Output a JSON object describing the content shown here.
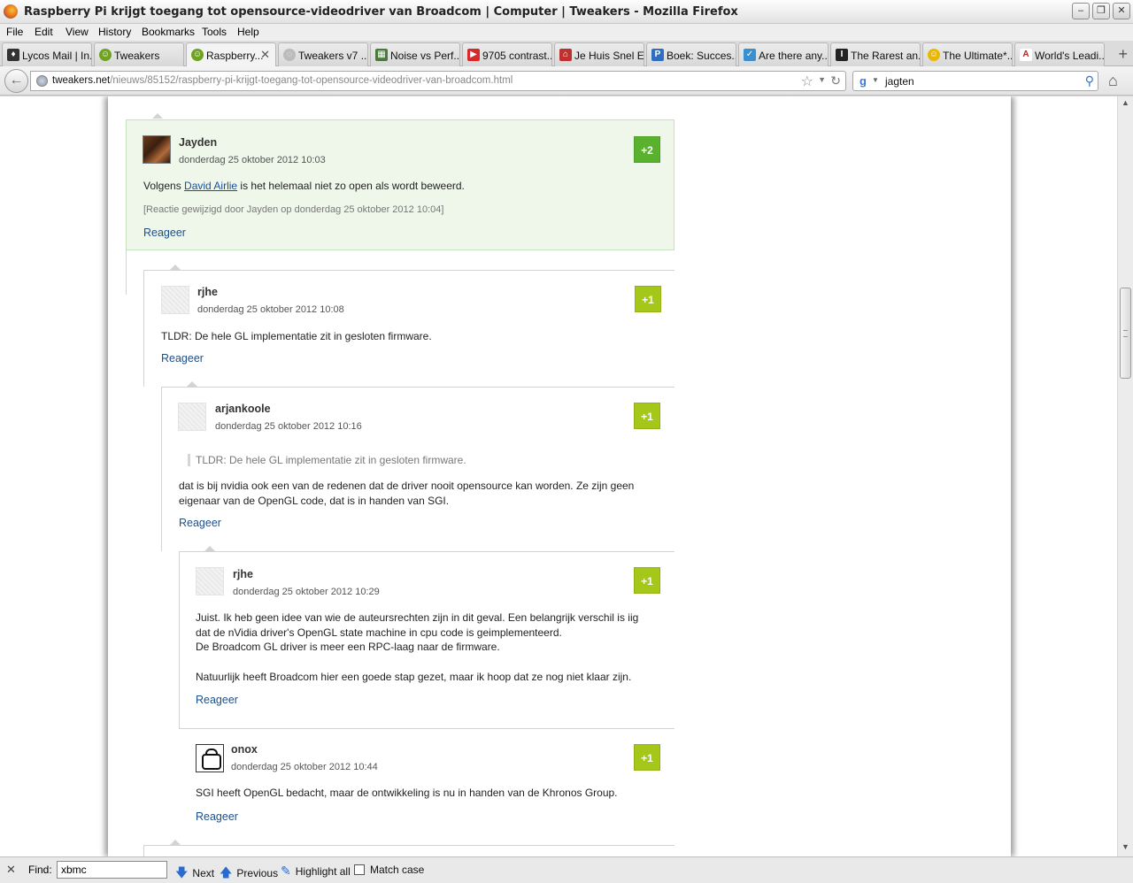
{
  "window": {
    "title": "Raspberry Pi krijgt toegang tot opensource-videodriver van Broadcom | Computer | Tweakers - Mozilla Firefox"
  },
  "menu": [
    "File",
    "Edit",
    "View",
    "History",
    "Bookmarks",
    "Tools",
    "Help"
  ],
  "tabs": [
    {
      "label": "Lycos Mail | In...",
      "icon": "dog-icon",
      "color": "#333333"
    },
    {
      "label": "Tweakers",
      "icon": "tweakers-icon",
      "color": "#6fa21f"
    },
    {
      "label": "Raspberry...",
      "icon": "tweakers-icon",
      "color": "#6fa21f",
      "active": true
    },
    {
      "label": "Tweakers v7 ...",
      "icon": "loading-icon",
      "color": "#aaaaaa"
    },
    {
      "label": "Noise vs Perf...",
      "icon": "image-icon",
      "color": "#4a7a3a"
    },
    {
      "label": "9705 contrast...",
      "icon": "youtube-icon",
      "color": "#d62a2a"
    },
    {
      "label": "Je Huis Snel E...",
      "icon": "house-icon",
      "color": "#c03030"
    },
    {
      "label": "Boek: Succes...",
      "icon": "p-icon",
      "color": "#2f6fc0"
    },
    {
      "label": "Are there any...",
      "icon": "check-icon",
      "color": "#3a8fd0"
    },
    {
      "label": "The Rarest an...",
      "icon": "bookmark-icon",
      "color": "#222222"
    },
    {
      "label": "The Ultimate*...",
      "icon": "smiley-icon",
      "color": "#e8b800"
    },
    {
      "label": "World's Leadi...",
      "icon": "a-icon",
      "color": "#c02020"
    }
  ],
  "nav": {
    "url_domain": "tweakers.net",
    "url_path": "/nieuws/85152/raspberry-pi-krijgt-toegang-tot-opensource-videodriver-van-broadcom.html",
    "search_value": "jagten"
  },
  "comments": [
    {
      "author": "Jayden",
      "date": "donderdag 25 oktober 2012 10:03",
      "score": "+2",
      "text_before": "Volgens ",
      "link": "David Airlie",
      "text_after": " is het helemaal niet zo open als wordt beweerd.",
      "edited": "[Reactie gewijzigd door Jayden op donderdag 25 oktober 2012 10:04]",
      "reply": "Reageer"
    },
    {
      "author": "rjhe",
      "date": "donderdag 25 oktober 2012 10:08",
      "score": "+1",
      "text": "TLDR: De hele GL implementatie zit in gesloten firmware.",
      "reply": "Reageer"
    },
    {
      "author": "arjankoole",
      "date": "donderdag 25 oktober 2012 10:16",
      "score": "+1",
      "quote": "TLDR: De hele GL implementatie zit in gesloten firmware.",
      "line1": "dat is bij nvidia ook een van de redenen dat de driver nooit opensource kan worden. Ze zijn geen",
      "line2": "eigenaar van de OpenGL code, dat is in handen van SGI.",
      "reply": "Reageer"
    },
    {
      "author": "rjhe",
      "date": "donderdag 25 oktober 2012 10:29",
      "score": "+1",
      "line1": "Juist. Ik heb geen idee van wie de auteursrechten zijn in dit geval. Een belangrijk verschil is iig",
      "line2": "dat de nVidia driver's OpenGL state machine in cpu code is geimplementeerd.",
      "line3": "De Broadcom GL driver is meer een RPC-laag naar de firmware.",
      "line4": "Natuurlijk heeft Broadcom hier een goede stap gezet, maar ik hoop dat ze nog niet klaar zijn.",
      "reply": "Reageer"
    },
    {
      "author": "onox",
      "date": "donderdag 25 oktober 2012 10:44",
      "score": "+1",
      "text": "SGI heeft OpenGL bedacht, maar de ontwikkeling is nu in handen van de Khronos Group.",
      "reply": "Reageer"
    }
  ],
  "findbar": {
    "label": "Find:",
    "value": "xbmc",
    "next": "Next",
    "previous": "Previous",
    "highlight": "Highlight all",
    "matchcase": "Match case"
  },
  "colors": {
    "score_high": "#5ab12d",
    "score_low": "#a4c719",
    "link": "#1a4f9a",
    "highlight_bg": "#eef7ea"
  }
}
